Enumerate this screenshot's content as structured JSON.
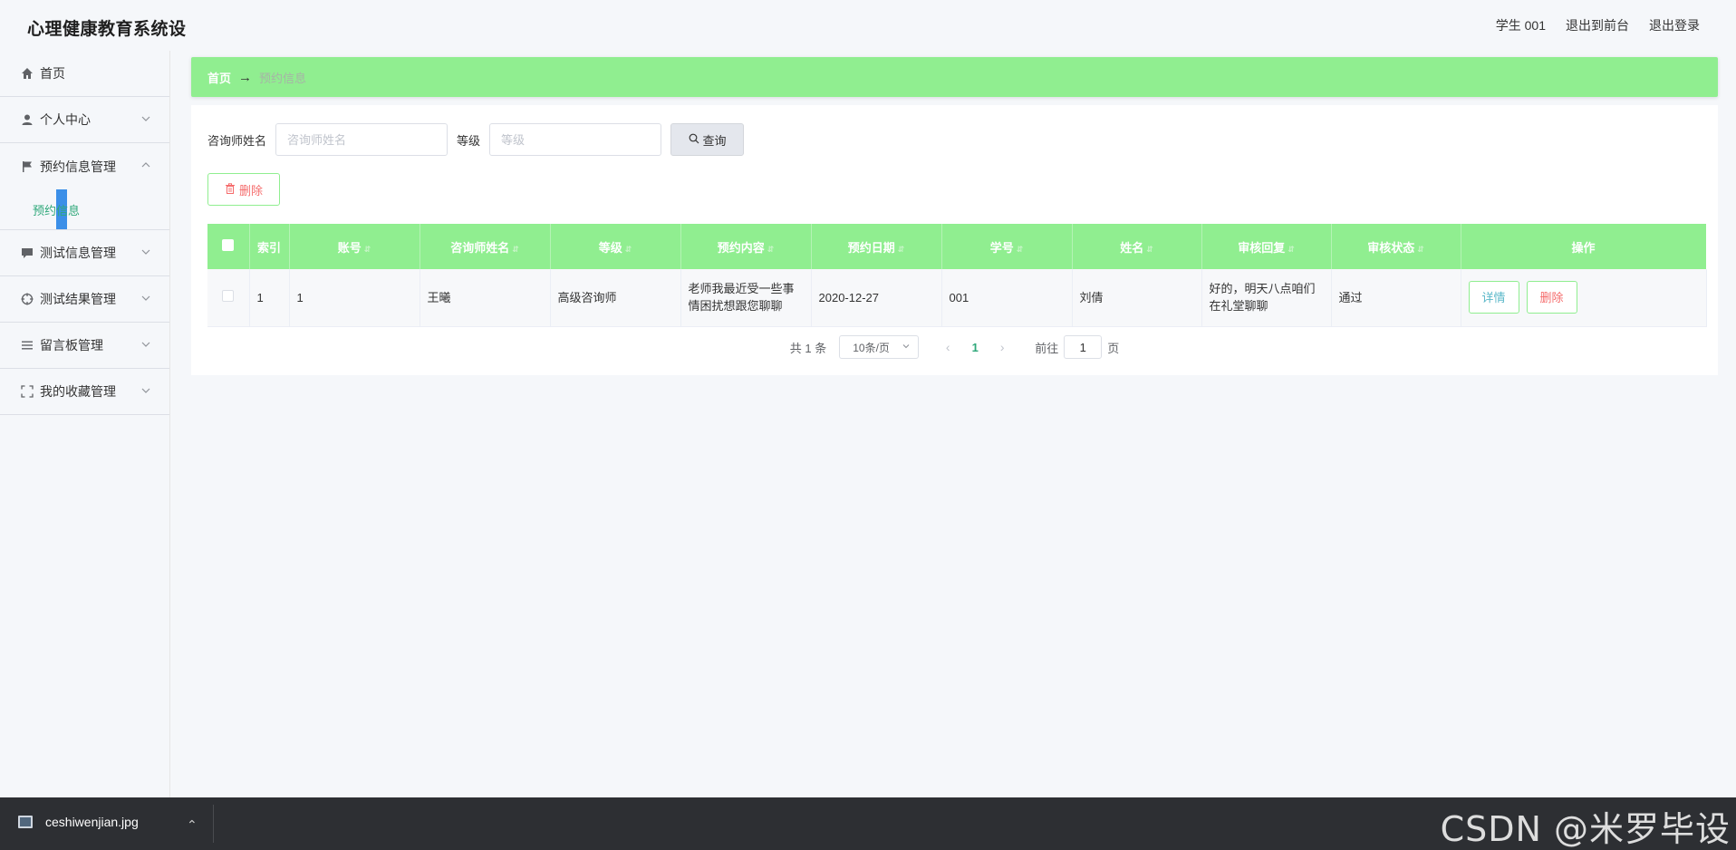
{
  "app": {
    "title": "心理健康教育系统设"
  },
  "top_links": [
    "学生 001",
    "退出到前台",
    "退出登录"
  ],
  "sidebar": {
    "items": [
      {
        "label": "首页",
        "icon": "home-icon"
      },
      {
        "label": "个人中心",
        "icon": "user-icon"
      },
      {
        "label": "预约信息管理",
        "icon": "flag-icon",
        "expanded": true,
        "children": [
          {
            "label": "预约信息"
          }
        ]
      },
      {
        "label": "测试信息管理",
        "icon": "chat-icon"
      },
      {
        "label": "测试结果管理",
        "icon": "target-icon"
      },
      {
        "label": "留言板管理",
        "icon": "list-icon"
      },
      {
        "label": "我的收藏管理",
        "icon": "fullscreen-icon"
      }
    ]
  },
  "breadcrumb": {
    "home": "首页",
    "separator": "→",
    "current": "预约信息"
  },
  "search": {
    "field1_label": "咨询师姓名",
    "field1_placeholder": "咨询师姓名",
    "field2_label": "等级",
    "field2_placeholder": "等级",
    "button": "查询"
  },
  "actions": {
    "delete": "删除"
  },
  "table": {
    "headers": [
      "索引",
      "账号",
      "咨询师姓名",
      "等级",
      "预约内容",
      "预约日期",
      "学号",
      "姓名",
      "审核回复",
      "审核状态",
      "操作"
    ],
    "rows": [
      {
        "index": "1",
        "account": "1",
        "counselor": "王曦",
        "level": "高级咨询师",
        "content": "老师我最近受一些事情困扰想跟您聊聊",
        "date": "2020-12-27",
        "student_id": "001",
        "name": "刘倩",
        "reply": "好的，明天八点咱们在礼堂聊聊",
        "status": "通过",
        "btn_detail": "详情",
        "btn_delete": "删除"
      }
    ]
  },
  "pagination": {
    "total": "共 1 条",
    "page_size": "10条/页",
    "current_page": "1",
    "goto_prefix": "前往",
    "goto_value": "1",
    "goto_suffix": "页"
  },
  "taskbar": {
    "file": "ceshiwenjian.jpg"
  },
  "watermark": "CSDN @米罗毕设",
  "colors": {
    "accent_green": "#90ee90",
    "danger": "#f56c6c",
    "selected_bar": "#3b8fe8"
  }
}
